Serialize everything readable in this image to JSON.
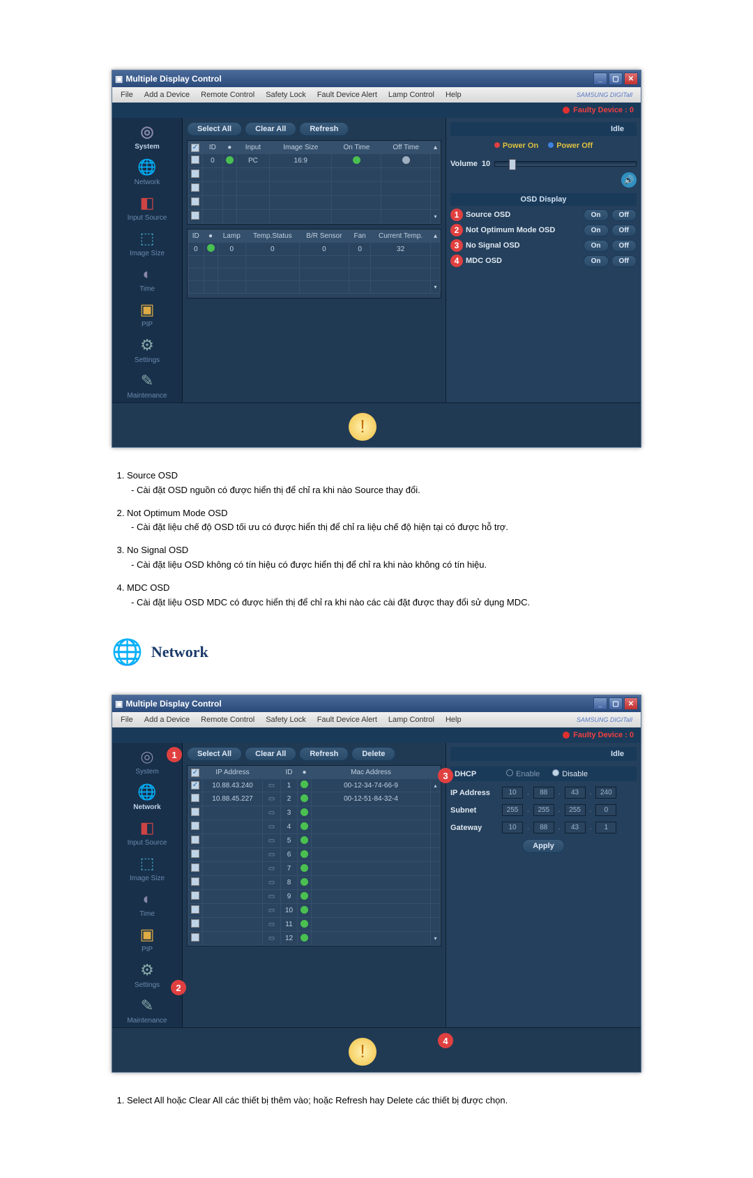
{
  "app": {
    "title": "Multiple Display Control",
    "menus": [
      "File",
      "Add a Device",
      "Remote Control",
      "Safety Lock",
      "Fault Device Alert",
      "Lamp Control",
      "Help"
    ],
    "brand": "SAMSUNG DIGITall",
    "faulty_label": "Faulty Device : 0",
    "sidebar": [
      {
        "key": "system",
        "label": "System"
      },
      {
        "key": "network",
        "label": "Network"
      },
      {
        "key": "input",
        "label": "Input Source"
      },
      {
        "key": "image",
        "label": "Image Size"
      },
      {
        "key": "time",
        "label": "Time"
      },
      {
        "key": "pip",
        "label": "PIP"
      },
      {
        "key": "settings",
        "label": "Settings"
      },
      {
        "key": "maint",
        "label": "Maintenance"
      }
    ],
    "buttons": {
      "select_all": "Select All",
      "clear_all": "Clear All",
      "refresh": "Refresh",
      "delete": "Delete",
      "apply": "Apply",
      "on": "On",
      "off": "Off",
      "idle": "Idle",
      "power_on": "Power On",
      "power_off": "Power Off"
    },
    "volume": {
      "label": "Volume",
      "value": "10"
    }
  },
  "screenshot1": {
    "selected_side": "system",
    "table1": {
      "headers": [
        "",
        "ID",
        "",
        "Input",
        "Image Size",
        "On Time",
        "Off Time"
      ],
      "row": {
        "id": "0",
        "input": "PC",
        "image_size": "16:9"
      }
    },
    "table2": {
      "headers": [
        "ID",
        "",
        "Lamp",
        "Temp.Status",
        "B/R Sensor",
        "Fan",
        "Current Temp."
      ],
      "row": {
        "id": "0",
        "lamp": "0",
        "temp_status": "0",
        "br": "0",
        "fan": "0",
        "current_temp": "32"
      }
    },
    "osd": {
      "title": "OSD Display",
      "rows": [
        {
          "num": "1",
          "label": "Source OSD"
        },
        {
          "num": "2",
          "label": "Not Optimum Mode OSD"
        },
        {
          "num": "3",
          "label": "No Signal OSD"
        },
        {
          "num": "4",
          "label": "MDC OSD"
        }
      ]
    }
  },
  "doc1": {
    "items": [
      {
        "title": "Source OSD",
        "body": "Cài đặt OSD nguồn có được hiển thị để chỉ ra khi nào Source thay đổi."
      },
      {
        "title": "Not Optimum Mode OSD",
        "body": "Cài đặt liệu chế độ OSD tối ưu có được hiển thị để chỉ ra liệu chế độ hiện tại có được hỗ trợ."
      },
      {
        "title": "No Signal OSD",
        "body": "Cài đặt liệu OSD không có tín hiệu có được hiển thị để chỉ ra khi nào không có tín hiệu."
      },
      {
        "title": "MDC OSD",
        "body": "Cài đặt liệu OSD MDC có được hiển thị để chỉ ra khi nào các cài đặt được thay đổi sử dụng MDC."
      }
    ]
  },
  "network_heading": "Network",
  "screenshot2": {
    "selected_side": "network",
    "table": {
      "headers": [
        "",
        "IP Address",
        "",
        "ID",
        "",
        "Mac Address"
      ],
      "rows": [
        {
          "ip": "10.88.43.240",
          "id": "1",
          "mac": "00-12-34-74-66-9"
        },
        {
          "ip": "10.88.45.227",
          "id": "2",
          "mac": "00-12-51-84-32-4"
        },
        {
          "ip": "",
          "id": "3",
          "mac": ""
        },
        {
          "ip": "",
          "id": "4",
          "mac": ""
        },
        {
          "ip": "",
          "id": "5",
          "mac": ""
        },
        {
          "ip": "",
          "id": "6",
          "mac": ""
        },
        {
          "ip": "",
          "id": "7",
          "mac": ""
        },
        {
          "ip": "",
          "id": "8",
          "mac": ""
        },
        {
          "ip": "",
          "id": "9",
          "mac": ""
        },
        {
          "ip": "",
          "id": "10",
          "mac": ""
        },
        {
          "ip": "",
          "id": "11",
          "mac": ""
        },
        {
          "ip": "",
          "id": "12",
          "mac": ""
        }
      ]
    },
    "dhcp": {
      "label": "DHCP",
      "enable": "Enable",
      "disable": "Disable",
      "selected": "disable"
    },
    "ip": {
      "label": "IP Address",
      "parts": [
        "10",
        "88",
        "43",
        "240"
      ]
    },
    "subnet": {
      "label": "Subnet",
      "parts": [
        "255",
        "255",
        "255",
        "0"
      ]
    },
    "gateway": {
      "label": "Gateway",
      "parts": [
        "10",
        "88",
        "43",
        "1"
      ]
    }
  },
  "doc2": {
    "items": [
      {
        "body": "Select All hoặc Clear All các thiết bị thêm vào; hoặc Refresh hay Delete các thiết bị được chọn."
      }
    ]
  }
}
